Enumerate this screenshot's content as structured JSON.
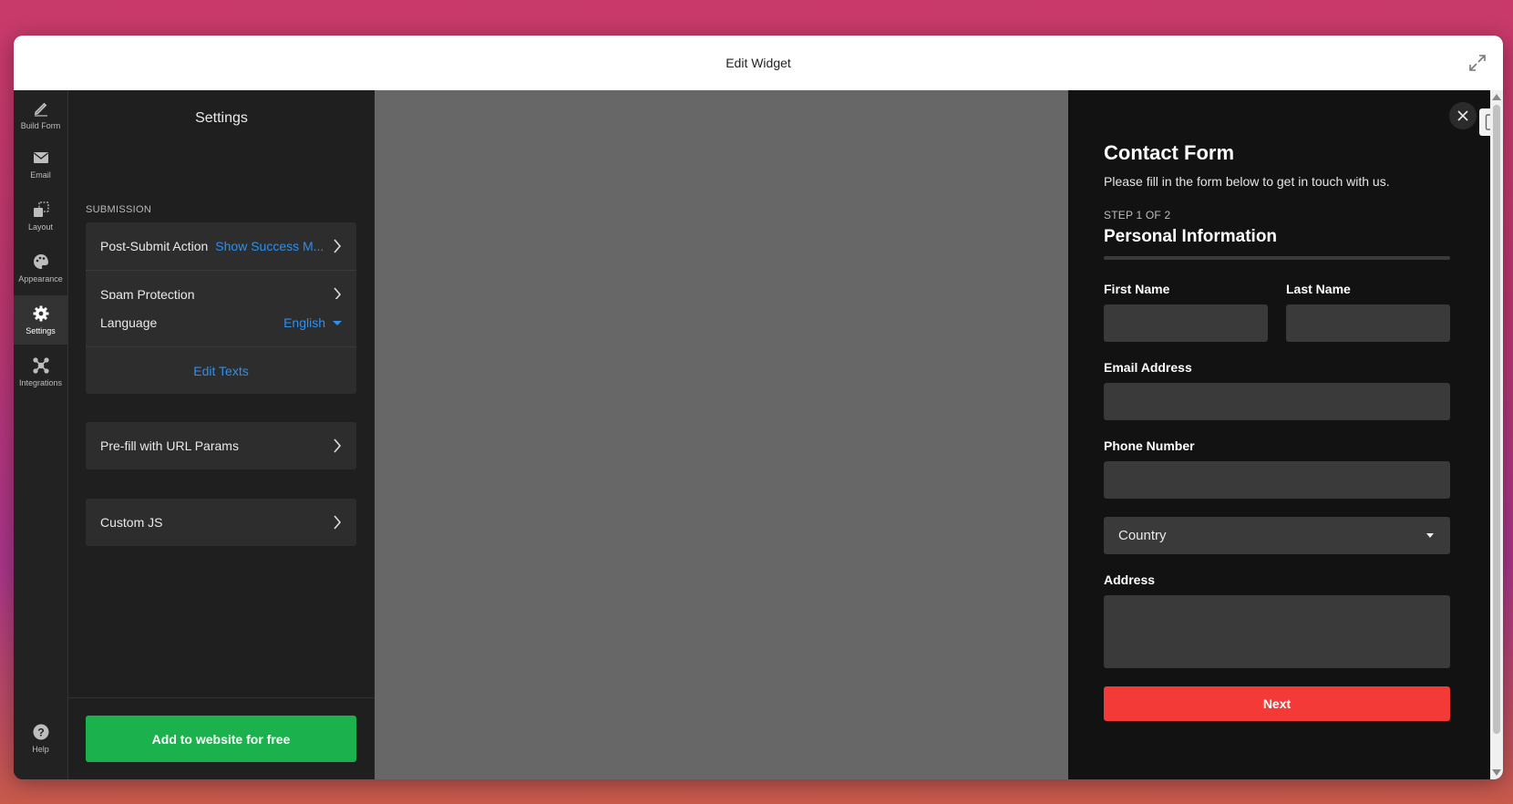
{
  "window": {
    "title": "Edit Widget"
  },
  "rail": {
    "items": [
      {
        "label": "Build Form",
        "icon": "pencil-icon"
      },
      {
        "label": "Email",
        "icon": "envelope-icon"
      },
      {
        "label": "Layout",
        "icon": "layout-icon"
      },
      {
        "label": "Appearance",
        "icon": "palette-icon"
      },
      {
        "label": "Settings",
        "icon": "gear-icon",
        "active": true
      },
      {
        "label": "Integrations",
        "icon": "integrations-icon"
      }
    ],
    "help": {
      "label": "Help",
      "icon": "help-icon"
    }
  },
  "settings": {
    "title": "Settings",
    "section_label": "SUBMISSION",
    "post_submit": {
      "label": "Post-Submit Action",
      "value": "Show Success M..."
    },
    "spam": {
      "label": "Spam Protection"
    },
    "language": {
      "label": "Language",
      "value": "English"
    },
    "edit_texts": "Edit Texts",
    "prefill": {
      "label": "Pre-fill with URL Params"
    },
    "custom_js": {
      "label": "Custom JS"
    },
    "cta": "Add to website for free"
  },
  "form": {
    "title": "Contact Form",
    "subtitle": "Please fill in the form below to get in touch with us.",
    "step": "STEP 1 OF 2",
    "step_title": "Personal Information",
    "first_name": "First Name",
    "last_name": "Last Name",
    "email": "Email Address",
    "phone": "Phone Number",
    "country": "Country",
    "address": "Address",
    "next": "Next"
  },
  "colors": {
    "accent_blue": "#2d8ff0",
    "cta_green": "#1bb24e",
    "next_red": "#f33a36"
  }
}
